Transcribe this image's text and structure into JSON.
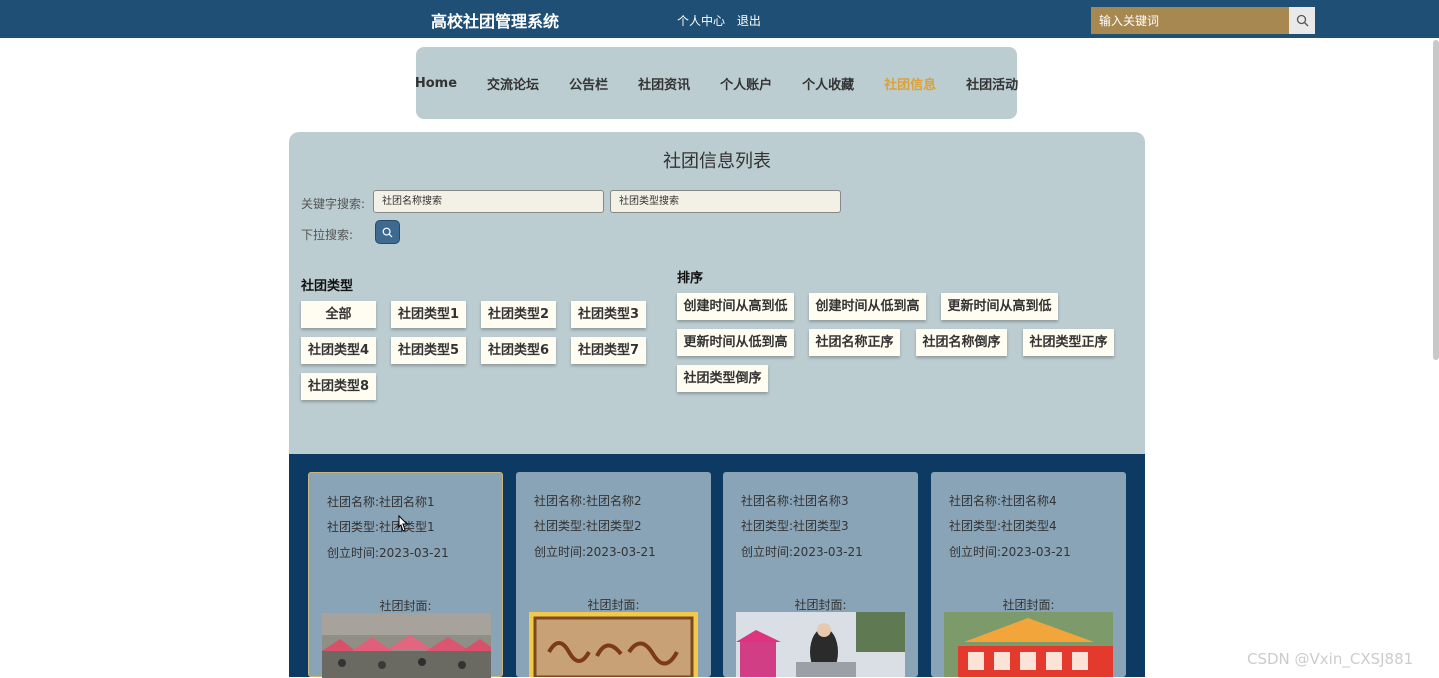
{
  "header": {
    "brand": "高校社团管理系统",
    "links": [
      "个人中心",
      "退出"
    ],
    "search_placeholder": "输入关键词"
  },
  "nav": {
    "items": [
      "Home",
      "交流论坛",
      "公告栏",
      "社团资讯",
      "个人账户",
      "个人收藏",
      "社团信息",
      "社团活动"
    ],
    "active": "社团信息"
  },
  "panel": {
    "title": "社团信息列表",
    "keyword_label": "关键字搜索:",
    "name_placeholder": "社团名称搜索",
    "type_placeholder": "社团类型搜索",
    "dropdown_label": "下拉搜索:",
    "type_section_title": "社团类型",
    "types": [
      "全部",
      "社团类型1",
      "社团类型2",
      "社团类型3",
      "社团类型4",
      "社团类型5",
      "社团类型6",
      "社团类型7",
      "社团类型8"
    ],
    "sort_section_title": "排序",
    "sorts": [
      "创建时间从高到低",
      "创建时间从低到高",
      "更新时间从高到低",
      "更新时间从低到高",
      "社团名称正序",
      "社团名称倒序",
      "社团类型正序",
      "社团类型倒序"
    ]
  },
  "cards": [
    {
      "name": "社团名称:社团名称1",
      "type": "社团类型:社团类型1",
      "date": "创立时间:2023-03-21",
      "cover_label": "社团封面:"
    },
    {
      "name": "社团名称:社团名称2",
      "type": "社团类型:社团类型2",
      "date": "创立时间:2023-03-21",
      "cover_label": "社团封面:"
    },
    {
      "name": "社团名称:社团名称3",
      "type": "社团类型:社团类型3",
      "date": "创立时间:2023-03-21",
      "cover_label": "社团封面:"
    },
    {
      "name": "社团名称:社团名称4",
      "type": "社团类型:社团类型4",
      "date": "创立时间:2023-03-21",
      "cover_label": "社团封面:"
    }
  ],
  "watermark": "CSDN @Vxin_CXSJ881",
  "colors": {
    "topbar": "#1f4f75",
    "panel": "#bccdd2",
    "active_nav": "#d9a23b",
    "search_bg": "#a88851",
    "cards_bg": "#0d3a63",
    "card": "#8aa4b7"
  },
  "icons": {
    "search_button": "magnifier-icon",
    "dropdown_search_button": "magnifier-icon"
  }
}
